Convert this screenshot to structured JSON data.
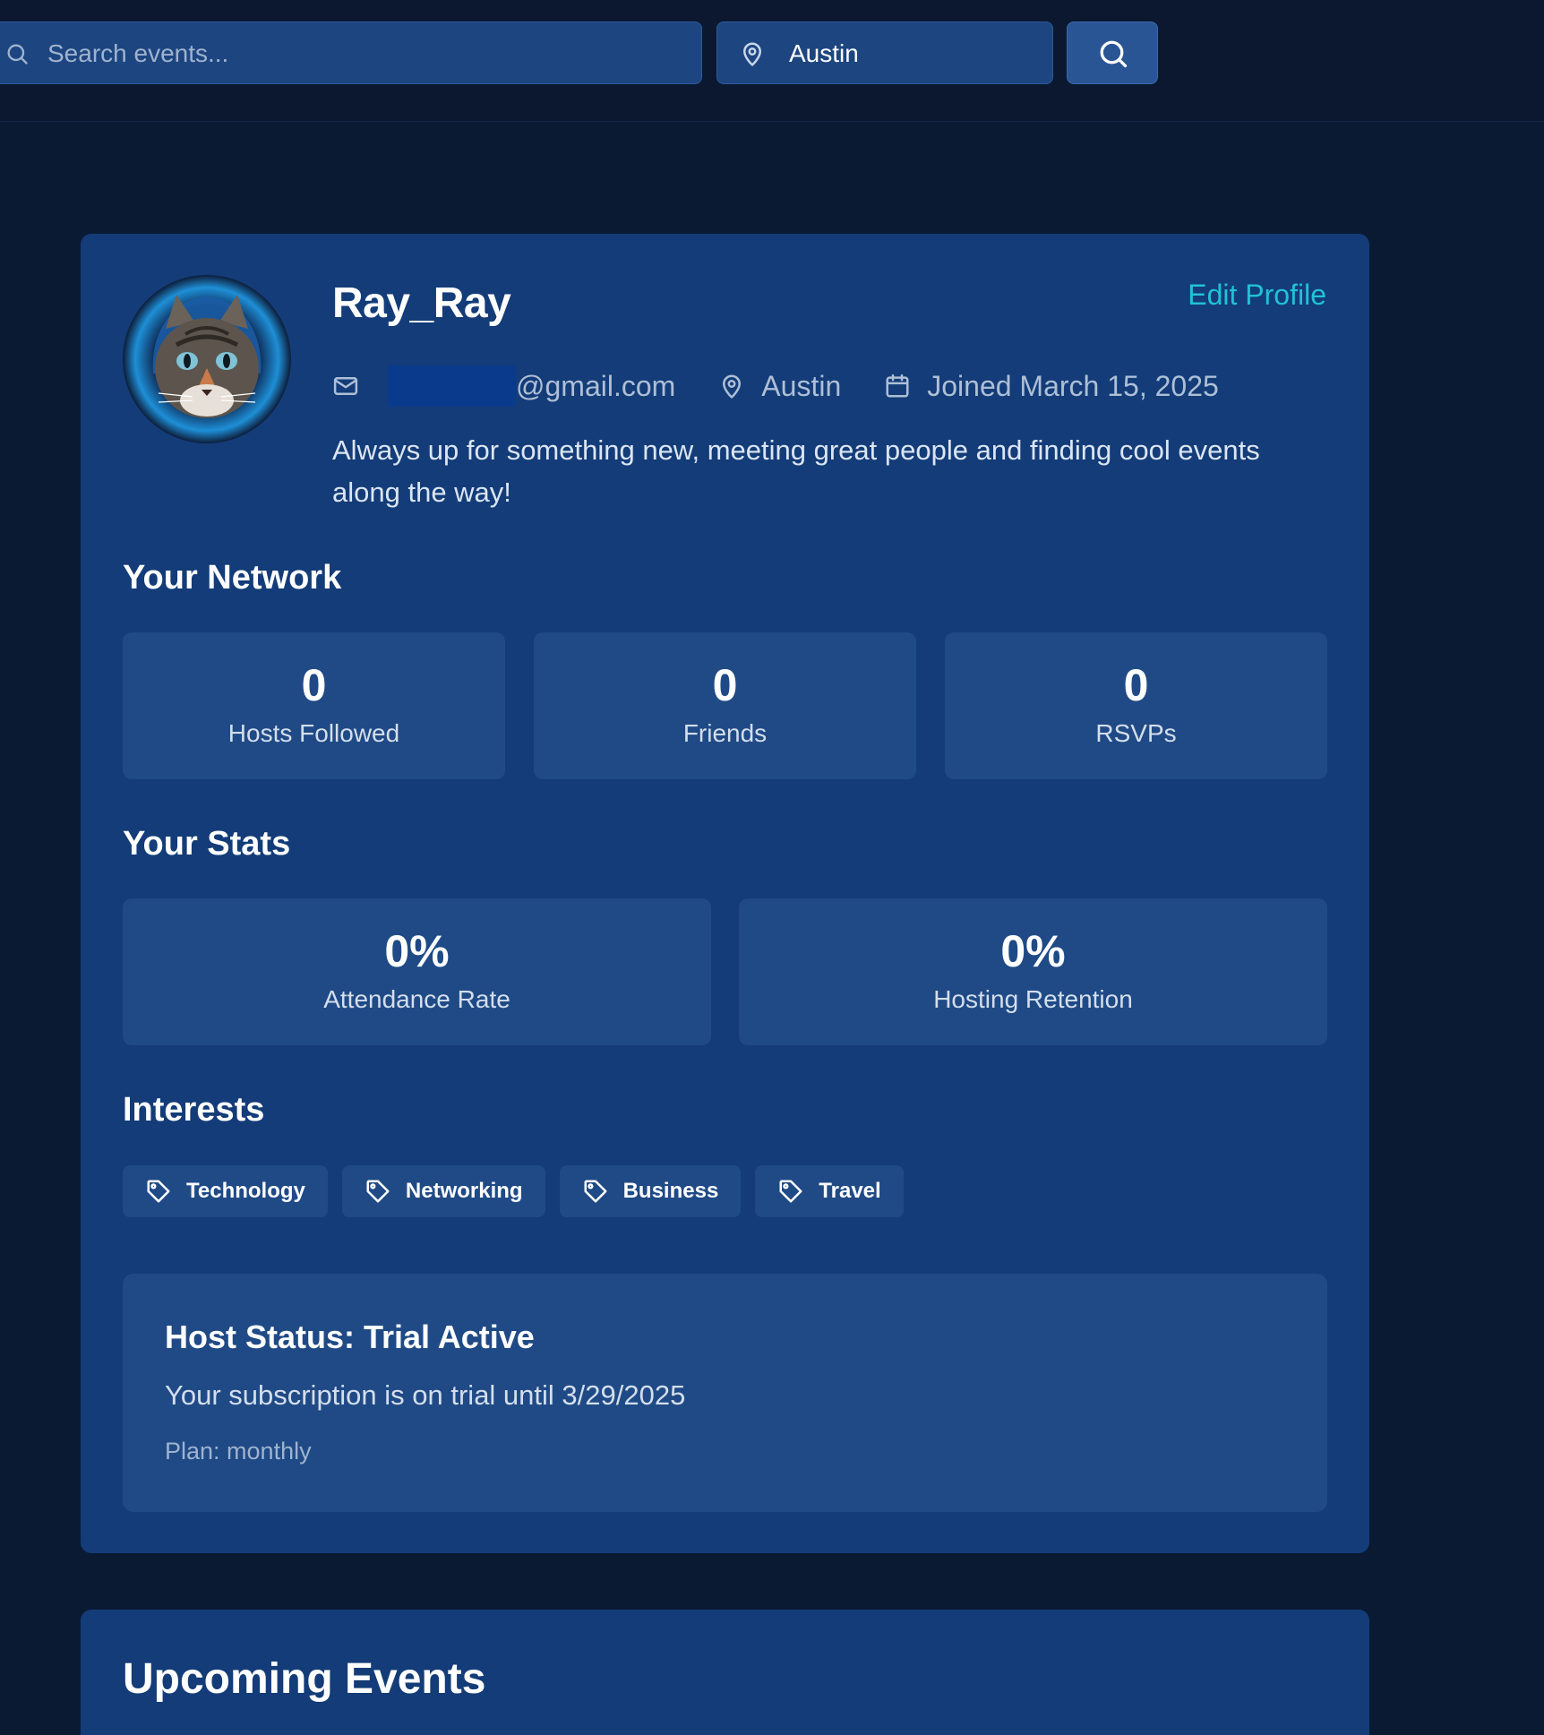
{
  "search": {
    "placeholder": "Search events...",
    "location_value": "Austin"
  },
  "profile": {
    "username": "Ray_Ray",
    "edit_label": "Edit Profile",
    "email_domain": "@gmail.com",
    "location": "Austin",
    "joined": "Joined March 15, 2025",
    "bio": "Always up for something new, meeting great people and finding cool events along the way!"
  },
  "network": {
    "title": "Your Network",
    "stats": [
      {
        "value": "0",
        "label": "Hosts Followed"
      },
      {
        "value": "0",
        "label": "Friends"
      },
      {
        "value": "0",
        "label": "RSVPs"
      }
    ]
  },
  "stats": {
    "title": "Your Stats",
    "items": [
      {
        "value": "0%",
        "label": "Attendance Rate"
      },
      {
        "value": "0%",
        "label": "Hosting Retention"
      }
    ]
  },
  "interests": {
    "title": "Interests",
    "tags": [
      "Technology",
      "Networking",
      "Business",
      "Travel"
    ]
  },
  "host_status": {
    "title": "Host Status: Trial Active",
    "text": "Your subscription is on trial until 3/29/2025",
    "plan": "Plan: monthly"
  },
  "upcoming": {
    "title": "Upcoming Events"
  },
  "colors": {
    "page_bg": "#0a1a33",
    "card_bg": "#133c78",
    "inner_box_bg": "#1f4a86",
    "accent_link": "#22c1d6"
  },
  "icons": {
    "search": "search-icon",
    "location": "map-pin-icon",
    "email": "mail-icon",
    "calendar": "calendar-icon",
    "tag": "tag-icon"
  }
}
